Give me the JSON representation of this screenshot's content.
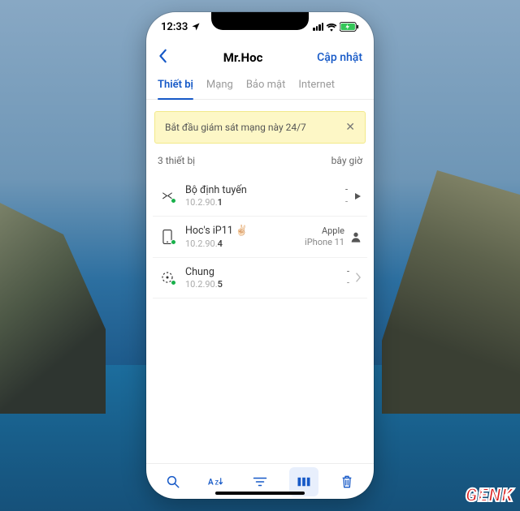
{
  "status": {
    "time": "12:33"
  },
  "nav": {
    "title": "Mr.Hoc",
    "update": "Cập nhật"
  },
  "tabs": [
    "Thiết bị",
    "Mạng",
    "Bảo mật",
    "Internet"
  ],
  "active_tab": 0,
  "banner": {
    "text": "Bắt đầu giám sát mạng này 24/7"
  },
  "summary": {
    "count": "3 thiết bị",
    "time": "bây giờ"
  },
  "devices": [
    {
      "name": "Bộ định tuyến",
      "ip_prefix": "10.2.90.",
      "ip_last": "1",
      "r1": "-",
      "r2": "-",
      "trail": "play"
    },
    {
      "name": "Hoc's iP11 ✌🏻",
      "ip_prefix": "10.2.90.",
      "ip_last": "4",
      "r1": "Apple",
      "r2": "iPhone 11",
      "trail": "user"
    },
    {
      "name": "Chung",
      "ip_prefix": "10.2.90.",
      "ip_last": "5",
      "r1": "-",
      "r2": "-",
      "trail": "chev"
    }
  ],
  "watermark": "GENK"
}
